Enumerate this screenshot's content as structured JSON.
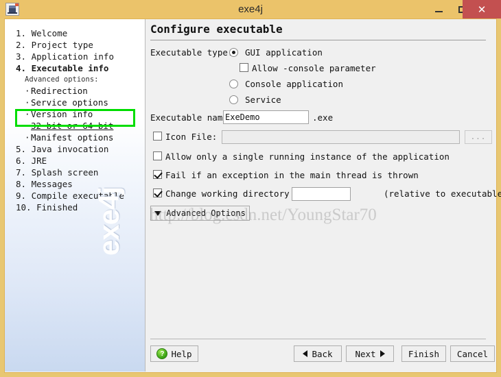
{
  "window": {
    "title": "exe4j",
    "app_icon": "app-window-icon",
    "minimize_label": "minimize-icon",
    "maximize_label": "maximize-icon",
    "close_label": "✕"
  },
  "sidebar": {
    "watermark": "exe4j",
    "items": [
      {
        "label": "1. Welcome",
        "type": "step"
      },
      {
        "label": "2. Project type",
        "type": "step"
      },
      {
        "label": "3. Application info",
        "type": "step"
      },
      {
        "label": "4. Executable info",
        "type": "step",
        "current": true
      },
      {
        "label": "Advanced options:",
        "type": "subhead"
      },
      {
        "label": "Redirection",
        "type": "sub"
      },
      {
        "label": "Service options",
        "type": "sub"
      },
      {
        "label": "Version info",
        "type": "sub"
      },
      {
        "label": "32-bit or 64-bit",
        "type": "sub",
        "active": true,
        "highlighted": true
      },
      {
        "label": "Manifest options",
        "type": "sub"
      },
      {
        "label": "5. Java invocation",
        "type": "step"
      },
      {
        "label": "6. JRE",
        "type": "step"
      },
      {
        "label": "7. Splash screen",
        "type": "step"
      },
      {
        "label": "8. Messages",
        "type": "step"
      },
      {
        "label": "9. Compile executable",
        "type": "step"
      },
      {
        "label": "10. Finished",
        "type": "step"
      }
    ],
    "highlight_color": "#00dd00"
  },
  "main": {
    "heading": "Configure executable",
    "executable_type_label": "Executable type:",
    "radios": [
      {
        "label": "GUI application",
        "checked": true
      },
      {
        "label": "Console application",
        "checked": false
      },
      {
        "label": "Service",
        "checked": false
      }
    ],
    "allow_console": {
      "label": "Allow -console parameter",
      "checked": false
    },
    "executable_name": {
      "label": "Executable name:",
      "value": "ExeDemo",
      "suffix": ".exe"
    },
    "icon_file": {
      "label": "Icon File:",
      "checked": false,
      "value": "",
      "browse_label": "..."
    },
    "checkboxes": [
      {
        "label": "Allow only a single running instance of the application",
        "checked": false
      },
      {
        "label": "Fail if an exception in the main thread is thrown",
        "checked": true
      }
    ],
    "working_directory": {
      "label": "Change working directory to:",
      "checked": true,
      "value": "",
      "note": "(relative to executable)"
    },
    "advanced_options_label": "Advanced Options"
  },
  "buttons": {
    "help": "Help",
    "help_icon_glyph": "?",
    "back": "Back",
    "next": "Next",
    "finish": "Finish",
    "cancel": "Cancel"
  },
  "watermark": {
    "text": "http://blog.csdn.net/YoungStar70"
  },
  "colors": {
    "window_chrome": "#ebc36a",
    "close_button": "#c35050",
    "panel_bg": "#f0f0f0",
    "highlight": "#00dd00"
  }
}
